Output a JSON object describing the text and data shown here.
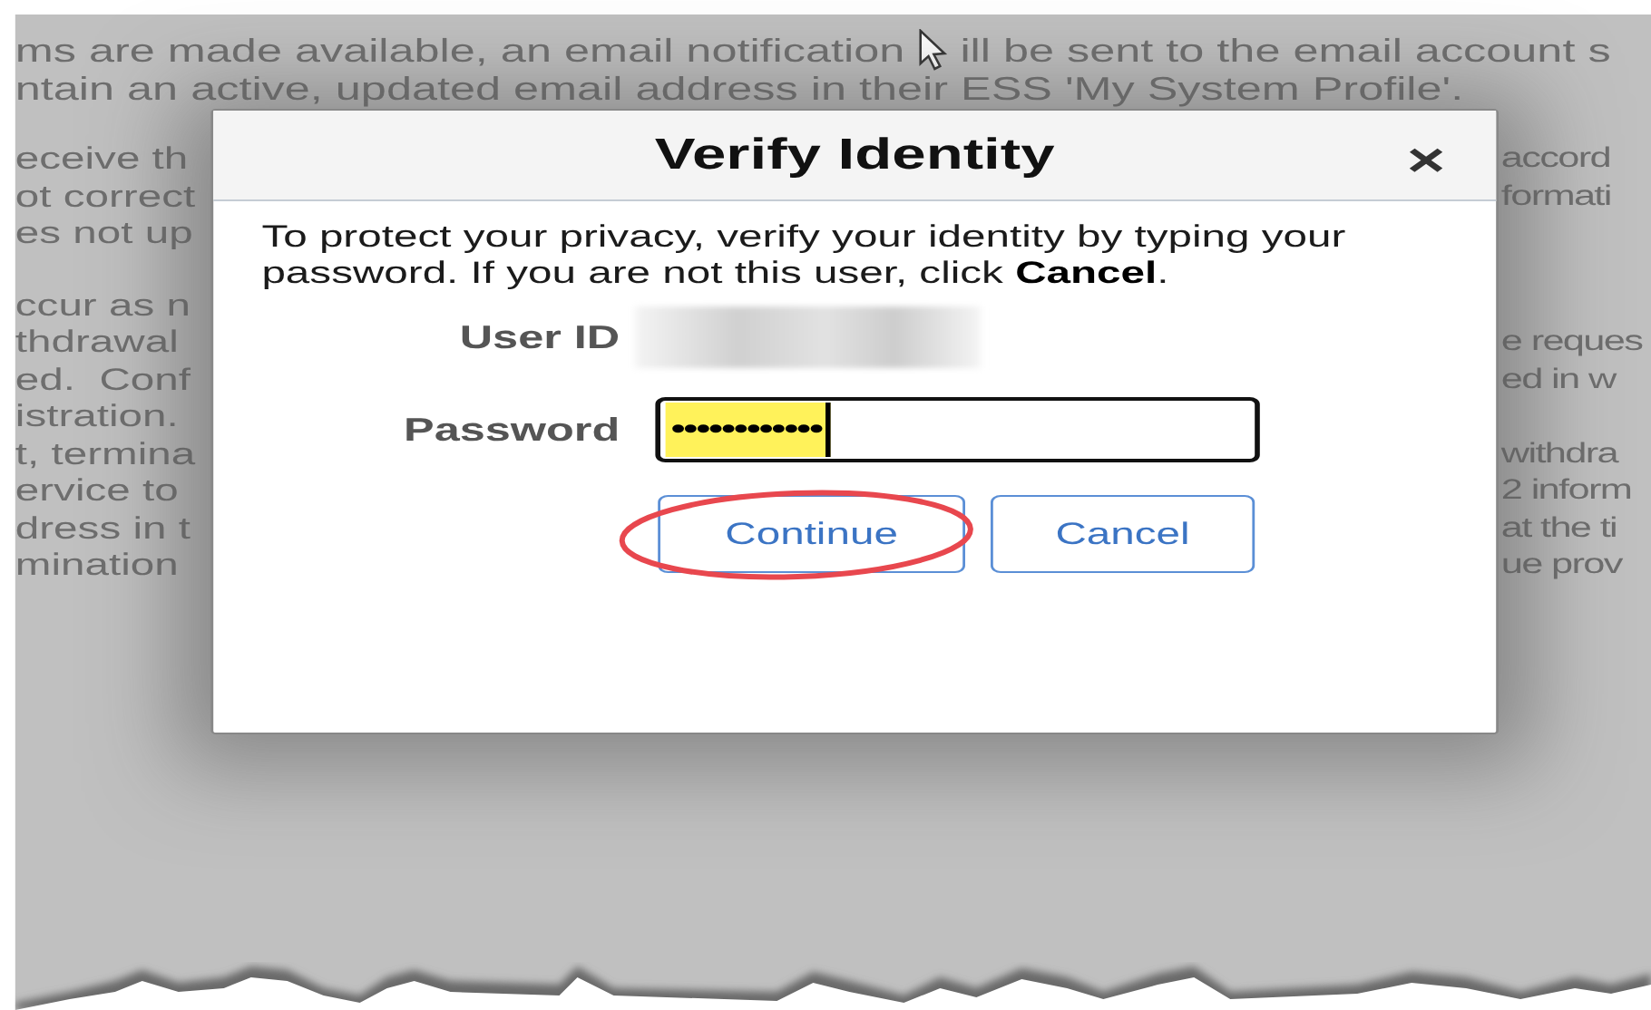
{
  "background": {
    "paragraphs": [
      [
        {
          "left": "ms are made available, an email notification",
          "right": "ill be sent to the email account s"
        },
        {
          "left": "ntain an active, updated email address in their ESS 'My System Profile'."
        }
      ],
      [
        {
          "left": "eceive th",
          "right": "accord"
        },
        {
          "left": "ot correct",
          "right": "formati"
        },
        {
          "left": "es not up"
        }
      ],
      [
        {
          "left": "ccur as n"
        },
        {
          "left": "thdrawal",
          "right": "e reques"
        },
        {
          "left": "ed.  Conf",
          "right": "ed in w"
        },
        {
          "left": "istration."
        },
        {
          "left": "t, termina",
          "right": "withdra"
        },
        {
          "left": "ervice to",
          "right": "2 inform"
        },
        {
          "left": "dress in t",
          "right": "at the ti"
        },
        {
          "left": "mination",
          "right": "ue prov"
        }
      ]
    ]
  },
  "dialog": {
    "title": "Verify Identity",
    "close": "×",
    "message": "To protect your privacy, verify your identity by typing your password. If you are not this user, click **Cancel**.",
    "fields": [
      {
        "label": "User ID",
        "kind": "redacted"
      },
      {
        "label": "Password",
        "kind": "password",
        "value": "••••••••••••"
      }
    ],
    "buttons": [
      {
        "label": "Continue",
        "highlighted": true
      },
      {
        "label": "Cancel",
        "highlighted": false
      }
    ]
  }
}
